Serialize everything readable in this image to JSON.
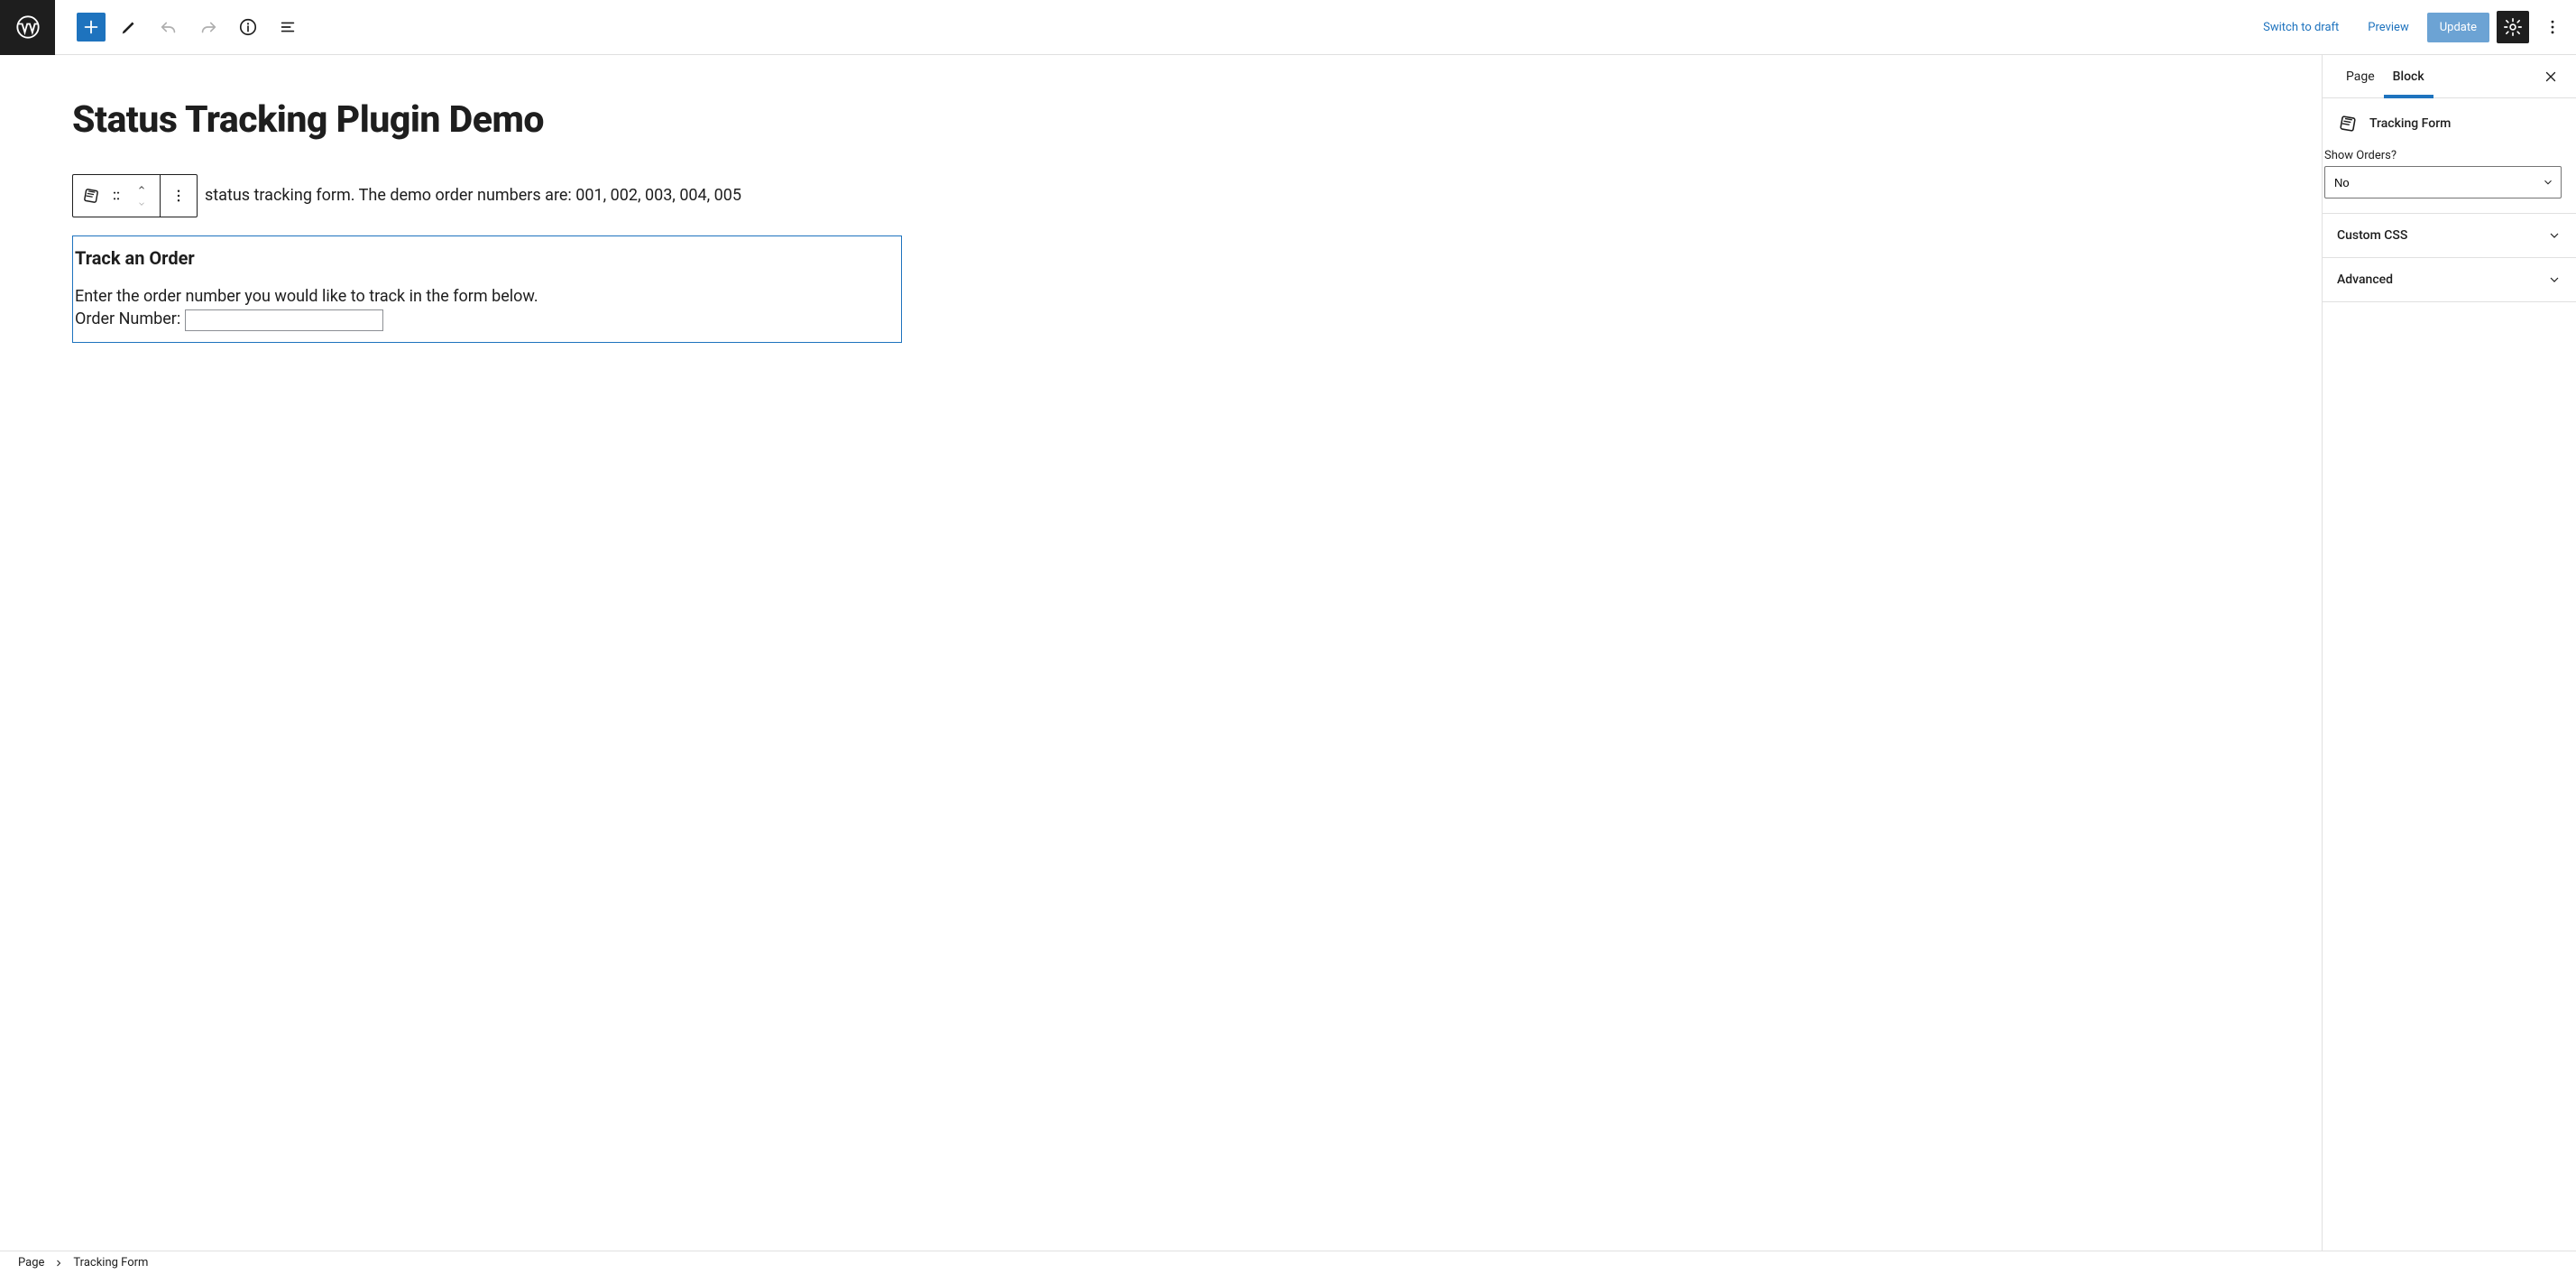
{
  "toolbar": {
    "switch_to_draft": "Switch to draft",
    "preview": "Preview",
    "update": "Update"
  },
  "page": {
    "title": "Status Tracking Plugin Demo",
    "intro": "status tracking form. The demo order numbers are: 001, 002, 003, 004, 005"
  },
  "tracking_block": {
    "heading": "Track an Order",
    "instructions": "Enter the order number you would like to track in the form below.",
    "order_label": "Order Number:"
  },
  "sidebar": {
    "tabs": {
      "page": "Page",
      "block": "Block"
    },
    "block_name": "Tracking Form",
    "show_orders_label": "Show Orders?",
    "show_orders_value": "No",
    "panels": {
      "custom_css": "Custom CSS",
      "advanced": "Advanced"
    }
  },
  "breadcrumb": {
    "root": "Page",
    "current": "Tracking Form"
  }
}
